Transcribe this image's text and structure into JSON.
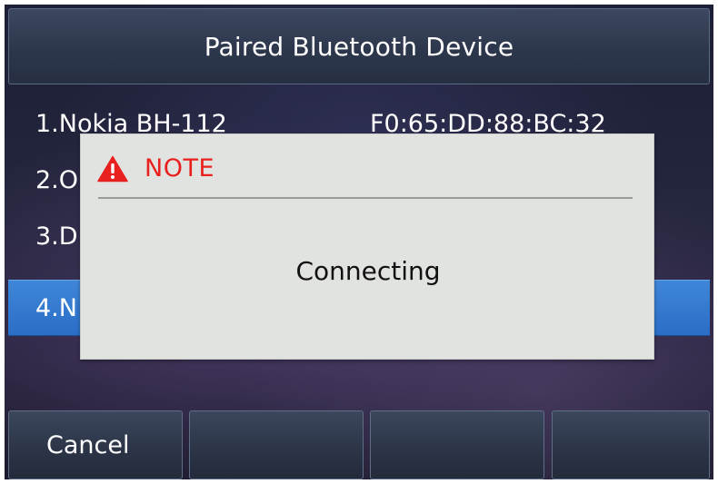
{
  "header": {
    "title": "Paired Bluetooth Device"
  },
  "devices": [
    {
      "name": "1.Nokia BH-112",
      "mac": "F0:65:DD:88:BC:32",
      "selected": false
    },
    {
      "name": "2.O",
      "mac": "",
      "selected": false
    },
    {
      "name": "3.D",
      "mac": "",
      "selected": false
    },
    {
      "name": "4.N",
      "mac": "",
      "selected": true
    }
  ],
  "softkeys": [
    "Cancel",
    "",
    "",
    ""
  ],
  "dialog": {
    "icon": "warning-triangle-icon",
    "title": "NOTE",
    "message": "Connecting"
  },
  "colors": {
    "selection": "#2f77cc",
    "note_title": "#e8201e",
    "dialog_bg": "#e1e3e0"
  }
}
